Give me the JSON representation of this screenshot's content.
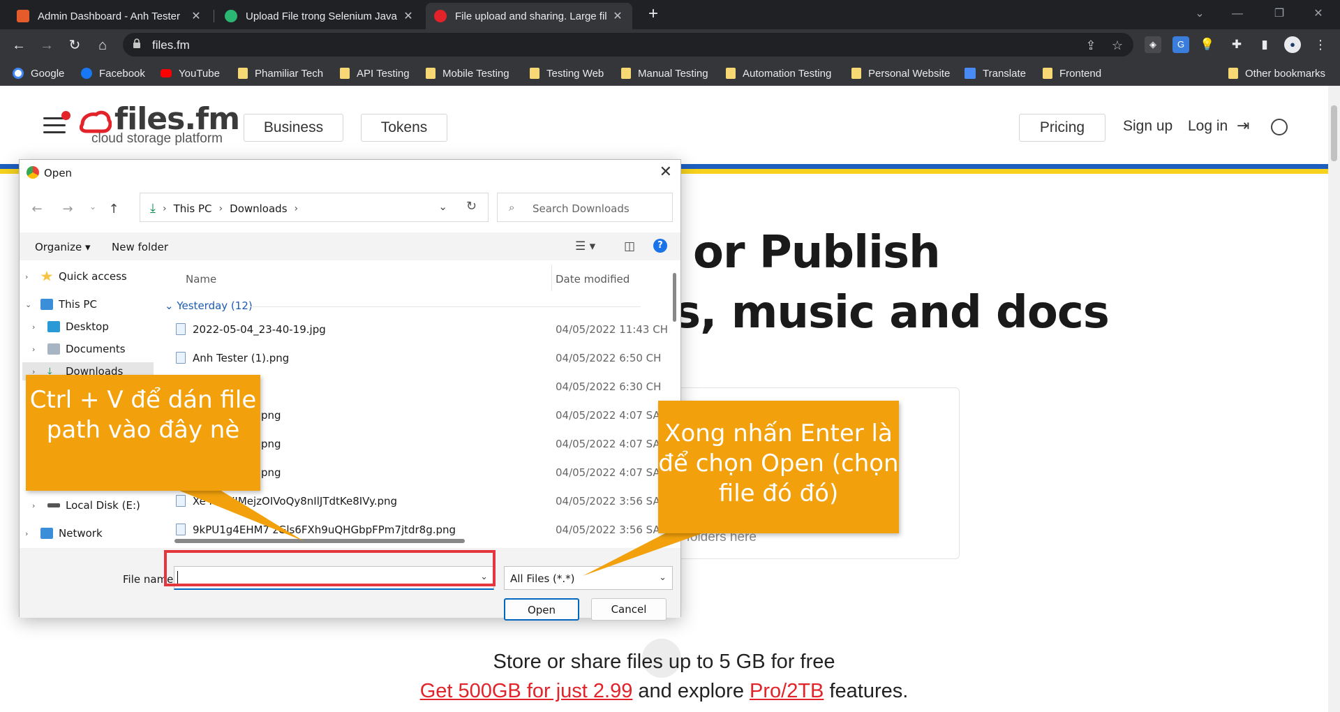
{
  "browser": {
    "tabs": [
      {
        "title": "Admin Dashboard - Anh Tester",
        "active": false,
        "favicon_color": "#e55b2c"
      },
      {
        "title": "Upload File trong Selenium Java",
        "active": false,
        "favicon_color": "#2bb673"
      },
      {
        "title": "File upload and sharing. Large fil",
        "active": true,
        "favicon_color": "#e2232a"
      }
    ],
    "close_glyph": "✕",
    "newtab_glyph": "+",
    "url": "files.fm",
    "bookmarks": [
      {
        "label": "Google",
        "icon": "google-icon"
      },
      {
        "label": "Facebook",
        "icon": "facebook-icon"
      },
      {
        "label": "YouTube",
        "icon": "youtube-icon"
      },
      {
        "label": "Phamiliar Tech",
        "icon": "folder-icon"
      },
      {
        "label": "API Testing",
        "icon": "folder-icon"
      },
      {
        "label": "Mobile Testing",
        "icon": "folder-icon"
      },
      {
        "label": "Testing Web",
        "icon": "folder-icon"
      },
      {
        "label": "Manual Testing",
        "icon": "folder-icon"
      },
      {
        "label": "Automation Testing",
        "icon": "folder-icon"
      },
      {
        "label": "Personal Website",
        "icon": "folder-icon"
      },
      {
        "label": "Translate",
        "icon": "translate-icon"
      },
      {
        "label": "Frontend",
        "icon": "folder-icon"
      }
    ],
    "other_bookmarks": "Other bookmarks"
  },
  "site": {
    "logo_text": "files.fm",
    "logo_sub": "cloud storage platform",
    "nav": {
      "business": "Business",
      "tokens": "Tokens",
      "pricing": "Pricing",
      "signup": "Sign up",
      "login": "Log in"
    },
    "hero_line1": "or Publish",
    "hero_line2": "s, music and docs",
    "drop_text": "r folders here",
    "store_text": "Store or share files up to 5 GB for free",
    "promo_link1": "Get 500GB for just 2.99",
    "promo_mid": " and explore ",
    "promo_link2": "Pro/2TB",
    "promo_end": " features.",
    "colors": {
      "brand_red": "#e2232a",
      "flag_blue": "#1d5fbf",
      "flag_yellow": "#f6d21c"
    }
  },
  "dialog": {
    "title": "Open",
    "close_glyph": "✕",
    "breadcrumb": [
      "This PC",
      "Downloads"
    ],
    "search_placeholder": "Search Downloads",
    "organize": "Organize ▾",
    "new_folder": "New folder",
    "help": "?",
    "nav_items": [
      {
        "label": "Quick access",
        "icon": "star-icon",
        "arrow": "›",
        "indent": 0
      },
      {
        "label": "This PC",
        "icon": "computer-icon",
        "arrow": "⌄",
        "indent": 0
      },
      {
        "label": "Desktop",
        "icon": "desktop-icon",
        "arrow": "›",
        "indent": 1
      },
      {
        "label": "Documents",
        "icon": "documents-icon",
        "arrow": "›",
        "indent": 1
      },
      {
        "label": "Downloads",
        "icon": "downloads-icon",
        "arrow": "›",
        "indent": 1
      },
      {
        "label": "Local Disk (E:)",
        "icon": "disk-icon",
        "arrow": "›",
        "indent": 1
      },
      {
        "label": "Network",
        "icon": "network-icon",
        "arrow": "›",
        "indent": 0
      }
    ],
    "col_name": "Name",
    "col_date": "Date modified",
    "group": "Yesterday (12)",
    "files": [
      {
        "name": "2022-05-04_23-40-19.jpg",
        "date": "04/05/2022 11:43 CH"
      },
      {
        "name": "Anh Tester (1).png",
        "date": "04/05/2022 6:50 CH"
      },
      {
        "name": "",
        "date": "04/05/2022 6:30 CH"
      },
      {
        "name": "png",
        "date": "04/05/2022 4:07 SA"
      },
      {
        "name": "png",
        "date": "04/05/2022 4:07 SA"
      },
      {
        "name": "png",
        "date": "04/05/2022 4:07 SA"
      },
      {
        "name": "Xe kLnXIMejzOIVoQy8nIlJTdtKe8IVy.png",
        "date": "04/05/2022 3:56 SA"
      },
      {
        "name": "9kPU1g4EHM7 zGls6FXh9uQHGbpFPm7jtdr8g.png",
        "date": "04/05/2022 3:56 SA"
      }
    ],
    "file_name_label": "File name:",
    "file_name_value": "",
    "filter": "All Files (*.*)",
    "open": "Open",
    "cancel": "Cancel"
  },
  "annotations": {
    "left_callout": "Ctrl + V để dán file path vào đây nè",
    "right_callout": "Xong nhấn Enter là để chọn Open (chọn file đó đó)",
    "callout_color": "#f2a10c",
    "highlight_color": "#e5353d"
  }
}
